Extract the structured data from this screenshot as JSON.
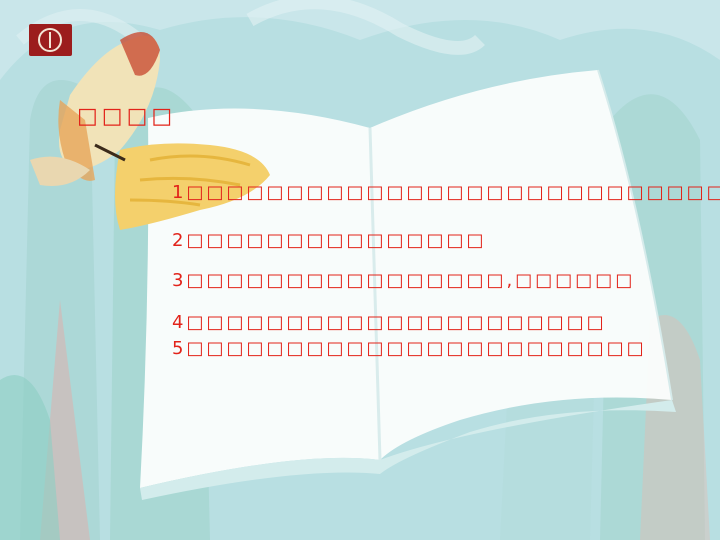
{
  "slide": {
    "title": "□□□□",
    "items": [
      "1□□□□□□□□□□□□□□□□□□□□□□□□□□□",
      "2□□□□□□□□□□□□□□□",
      "3□□□□□□□□□□□□□□□□,□□□□□□",
      "4□□□□□□□□□□□□□□□□□□□□□",
      "5□□□□□□□□□□□□□□□□□□□□□□□"
    ]
  }
}
